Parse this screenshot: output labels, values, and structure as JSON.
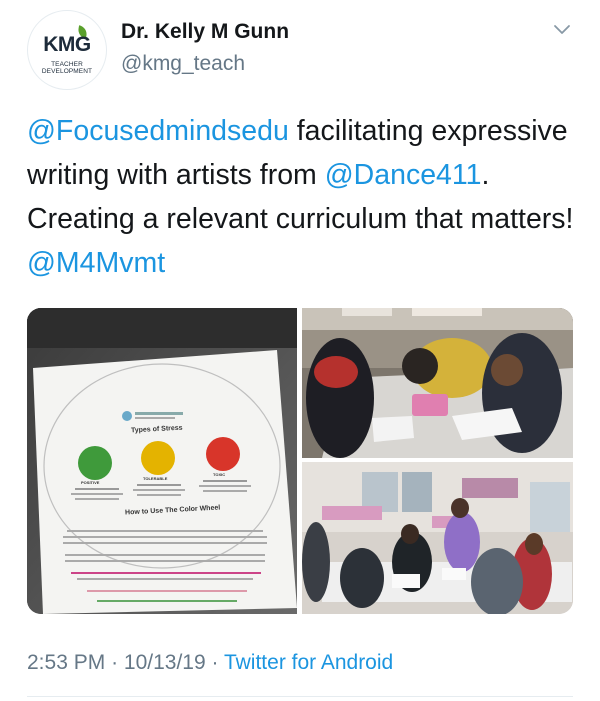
{
  "author": {
    "display_name": "Dr. Kelly M Gunn",
    "handle": "@kmg_teach",
    "avatar_text": "KMG",
    "avatar_subtext": "TEACHER DEVELOPMENT"
  },
  "tweet": {
    "segments": [
      {
        "text": "@Focusedmindsedu",
        "type": "mention"
      },
      {
        "text": " facilitating expressive writing with artists from ",
        "type": "text"
      },
      {
        "text": "@Dance411",
        "type": "mention"
      },
      {
        "text": ". Creating a relevant curriculum that matters! ",
        "type": "text"
      },
      {
        "text": "@M4Mvmt",
        "type": "mention"
      }
    ]
  },
  "media": {
    "left_image": {
      "doc_title": "Types of Stress",
      "circles": [
        {
          "label": "GREEN",
          "caption": "POSITIVE",
          "color": "#3f9a3b"
        },
        {
          "label": "YELLOW",
          "caption": "TOLERABLE",
          "color": "#e4b300"
        },
        {
          "label": "RED",
          "caption": "TOXIC",
          "color": "#d8352a"
        }
      ],
      "section_title": "How to Use The Color Wheel"
    }
  },
  "footer": {
    "time": "2:53 PM",
    "separator": "·",
    "date": "10/13/19",
    "source": "Twitter for Android"
  },
  "colors": {
    "link": "#1b95e0",
    "secondary_text": "#657786",
    "primary_text": "#14171a"
  },
  "icons": {
    "caret": "chevron-down-icon"
  }
}
